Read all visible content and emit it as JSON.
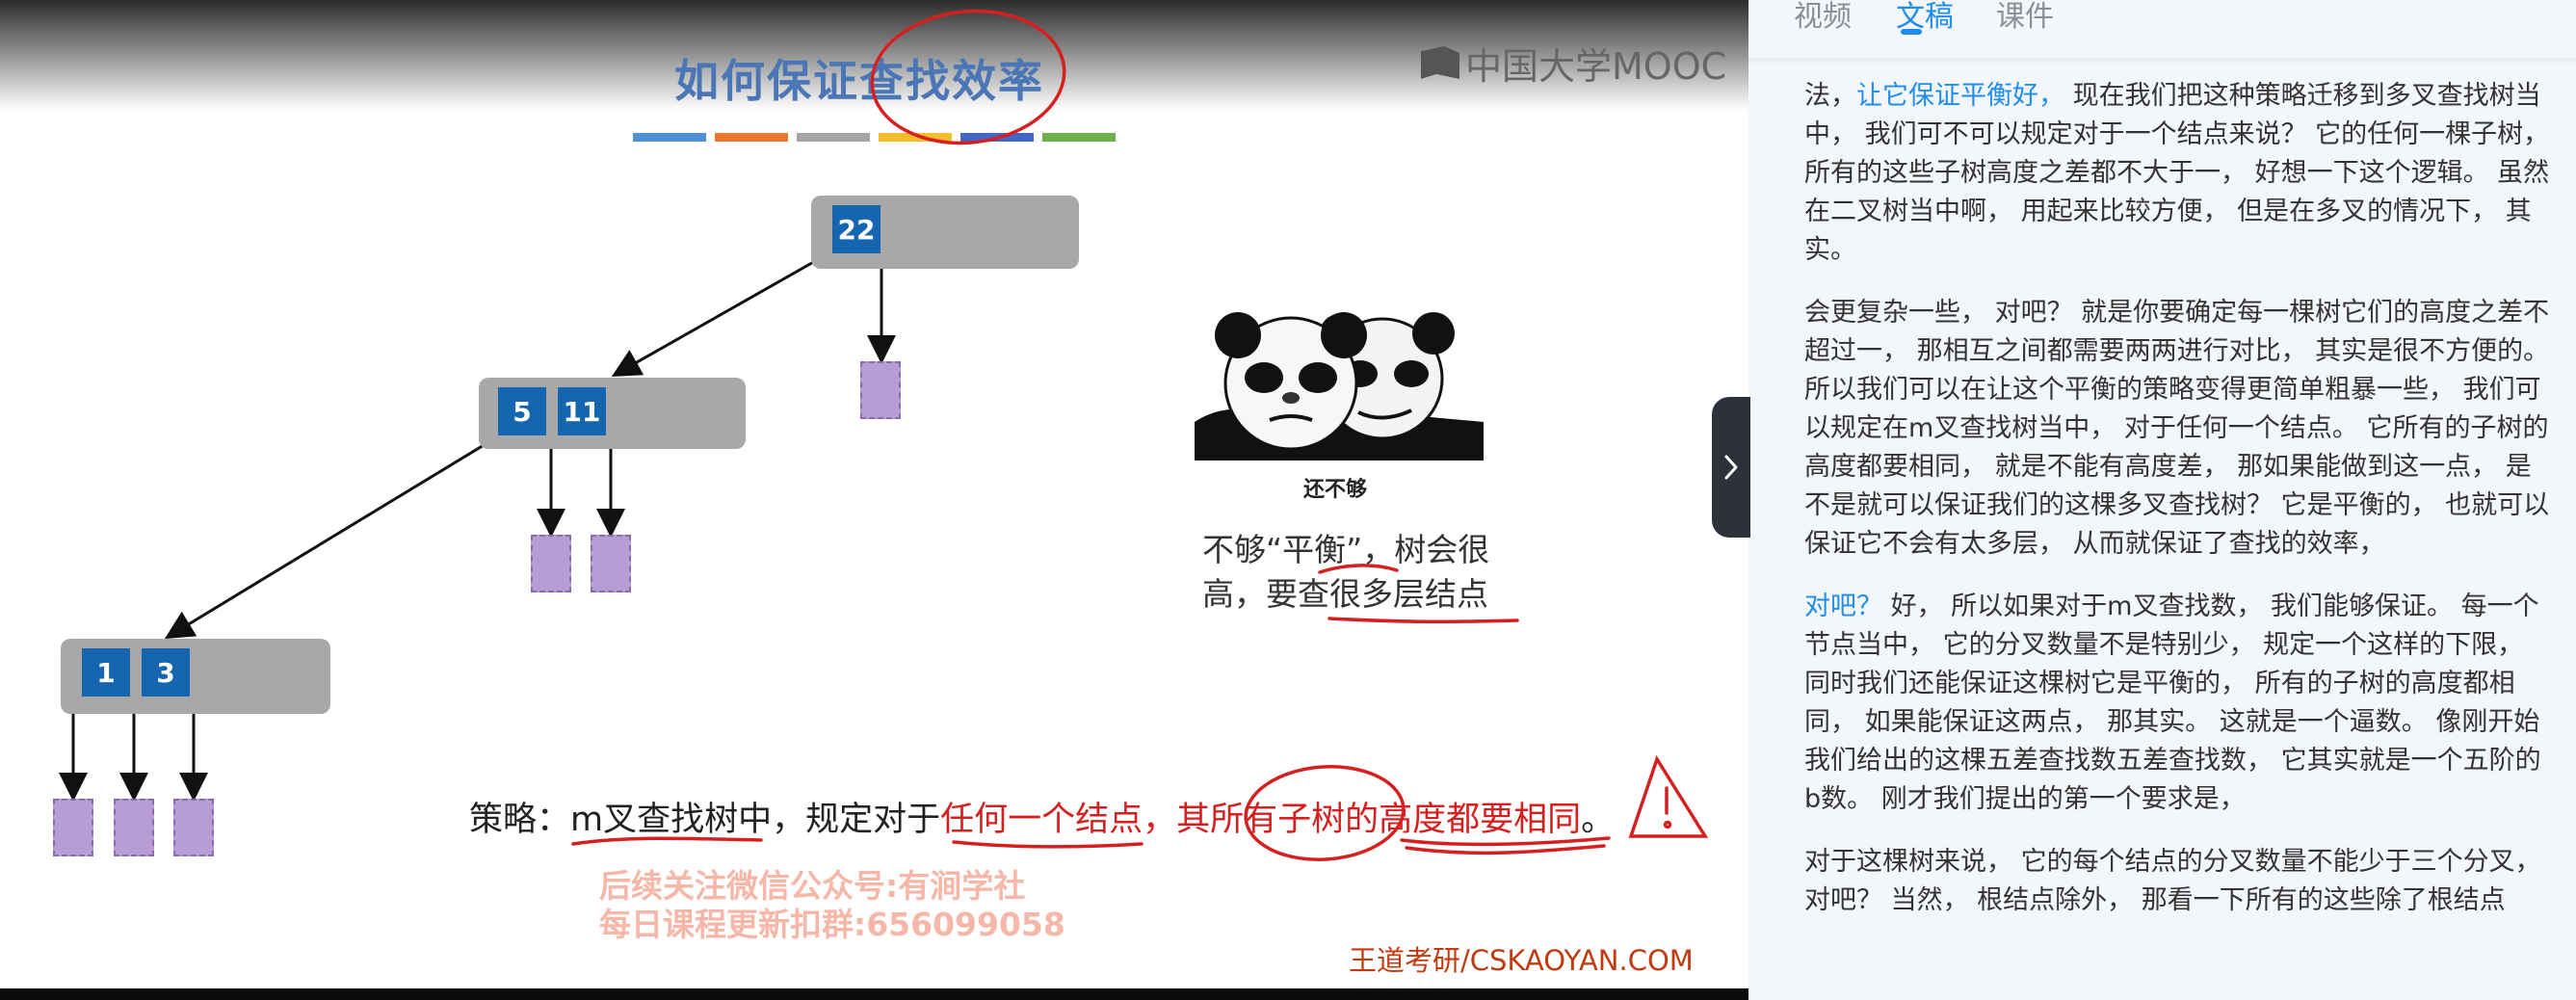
{
  "slide": {
    "title": "如何保证查找效率",
    "watermark_logo": "中国大学MOOC",
    "bar_colors": [
      "#4f8fd4",
      "#e8792e",
      "#a5a5a5",
      "#f2be2c",
      "#4367c7",
      "#6db04c"
    ],
    "tree": {
      "root_keys": [
        "22"
      ],
      "mid_keys": [
        "5",
        "11"
      ],
      "left_keys": [
        "1",
        "3"
      ]
    },
    "meme_caption": "还不够",
    "note_line1": "不够“平衡”，树会很",
    "note_line2": "高，要查很多层结点",
    "strategy_prefix": "策略：",
    "strategy_a": "m叉查找树中，规定对于",
    "strategy_b": "任何一个结点，其所有子树的高度都要相同",
    "strategy_end": "。",
    "ad_line1": "后续关注微信公众号:有涧学社",
    "ad_line2": "每日课程更新扣群:656099058",
    "footer_source": "王道考研/CSKAOYAN.COM",
    "accent_color": "#d62020"
  },
  "tabs": [
    "视频",
    "文稿",
    "课件"
  ],
  "active_tab": "文稿",
  "transcript": {
    "p1_a": "法，",
    "p1_b": "让它保证平衡好，",
    "p1_c": " 现在我们把这种策略迁移到多叉查找树当中， 我们可不可以规定对于一个结点来说？ 它的任何一棵子树， 所有的这些子树高度之差都不大于一， 好想一下这个逻辑。 虽然在二叉树当中啊， 用起来比较方便， 但是在多叉的情况下， 其实。",
    "p2": "会更复杂一些， 对吧？ 就是你要确定每一棵树它们的高度之差不超过一， 那相互之间都需要两两进行对比， 其实是很不方便的。 所以我们可以在让这个平衡的策略变得更简单粗暴一些， 我们可以规定在m叉查找树当中， 对于任何一个结点。 它所有的子树的高度都要相同， 就是不能有高度差， 那如果能做到这一点， 是不是就可以保证我们的这棵多叉查找树？ 它是平衡的， 也就可以保证它不会有太多层， 从而就保证了查找的效率，",
    "p3_a": "对吧？",
    "p3_b": " 好， 所以如果对于m叉查找数， 我们能够保证。 每一个节点当中， 它的分叉数量不是特别少， 规定一个这样的下限， 同时我们还能保证这棵树它是平衡的， 所有的子树的高度都相同， 如果能保证这两点， 那其实。 这就是一个逼数。 像刚开始我们给出的这棵五差查找数五差查找数， 它其实就是一个五阶的b数。 刚才我们提出的第一个要求是，",
    "p4": "对于这棵树来说， 它的每个结点的分叉数量不能少于三个分叉， 对吧？ 当然， 根结点除外， 那看一下所有的这些除了根结点"
  }
}
